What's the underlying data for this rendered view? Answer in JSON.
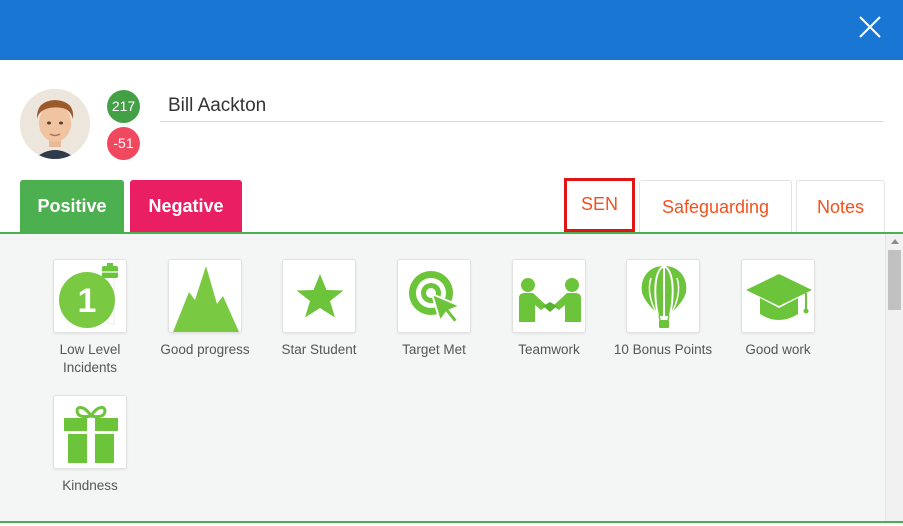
{
  "header": {
    "close_icon": "close-icon",
    "bar_color": "#1976d2"
  },
  "student": {
    "name": "Bill Aackton",
    "positive_points": "217",
    "negative_points": "-51"
  },
  "tabs": {
    "positive": "Positive",
    "negative": "Negative",
    "sen": "SEN",
    "safeguarding": "Safeguarding",
    "notes": "Notes"
  },
  "awards": [
    {
      "label": "Low Level Incidents",
      "icon": "number-one-badge-icon"
    },
    {
      "label": "Good progress",
      "icon": "mountain-icon"
    },
    {
      "label": "Star Student",
      "icon": "star-icon"
    },
    {
      "label": "Target Met",
      "icon": "target-icon"
    },
    {
      "label": "Teamwork",
      "icon": "handshake-icon"
    },
    {
      "label": "10 Bonus Points",
      "icon": "hot-air-balloon-icon"
    },
    {
      "label": "Good work",
      "icon": "graduation-cap-icon"
    },
    {
      "label": "Kindness",
      "icon": "gift-icon"
    }
  ],
  "colors": {
    "positive": "#4caf50",
    "negative": "#e91e63",
    "tab_text": "#f4511e",
    "highlight_border": "#e01616",
    "icon_green": "#6cc43a"
  }
}
